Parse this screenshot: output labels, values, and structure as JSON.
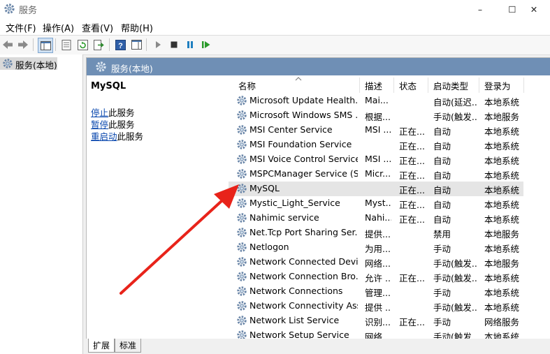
{
  "window": {
    "title": "服务",
    "minimize": "–",
    "maximize": "☐",
    "close": "✕"
  },
  "menu": [
    "文件(F)",
    "操作(A)",
    "查看(V)",
    "帮助(H)"
  ],
  "tree": {
    "root_label": "服务(本地)"
  },
  "panel": {
    "header": "服务(本地)",
    "selected_service": "MySQL",
    "actions": [
      {
        "link": "停止",
        "rest": "此服务"
      },
      {
        "link": "暂停",
        "rest": "此服务"
      },
      {
        "link": "重启动",
        "rest": "此服务"
      }
    ]
  },
  "columns": {
    "name": "名称",
    "desc": "描述",
    "status": "状态",
    "startup": "启动类型",
    "logon": "登录为"
  },
  "rows": [
    {
      "name": "Microsoft Update Health...",
      "desc": "Mai...",
      "status": "",
      "startup": "自动(延迟...",
      "logon": "本地系统"
    },
    {
      "name": "Microsoft Windows SMS ...",
      "desc": "根据...",
      "status": "",
      "startup": "手动(触发...",
      "logon": "本地服务"
    },
    {
      "name": "MSI Center Service",
      "desc": "MSI ...",
      "status": "正在...",
      "startup": "自动",
      "logon": "本地系统"
    },
    {
      "name": "MSI Foundation Service",
      "desc": "",
      "status": "正在...",
      "startup": "自动",
      "logon": "本地系统"
    },
    {
      "name": "MSI Voice Control Service",
      "desc": "MSI ...",
      "status": "正在...",
      "startup": "自动",
      "logon": "本地系统"
    },
    {
      "name": "MSPCManager Service (S...",
      "desc": "Micr...",
      "status": "正在...",
      "startup": "自动",
      "logon": "本地系统"
    },
    {
      "name": "MySQL",
      "desc": "",
      "status": "正在...",
      "startup": "自动",
      "logon": "本地系统",
      "selected": true
    },
    {
      "name": "Mystic_Light_Service",
      "desc": "Myst...",
      "status": "正在...",
      "startup": "自动",
      "logon": "本地系统"
    },
    {
      "name": "Nahimic service",
      "desc": "Nahi...",
      "status": "正在...",
      "startup": "自动",
      "logon": "本地系统"
    },
    {
      "name": "Net.Tcp Port Sharing Ser...",
      "desc": "提供...",
      "status": "",
      "startup": "禁用",
      "logon": "本地服务"
    },
    {
      "name": "Netlogon",
      "desc": "为用...",
      "status": "",
      "startup": "手动",
      "logon": "本地系统"
    },
    {
      "name": "Network Connected Devi...",
      "desc": "网络...",
      "status": "",
      "startup": "手动(触发...",
      "logon": "本地服务"
    },
    {
      "name": "Network Connection Bro...",
      "desc": "允许 ...",
      "status": "正在...",
      "startup": "手动(触发...",
      "logon": "本地系统"
    },
    {
      "name": "Network Connections",
      "desc": "管理...",
      "status": "",
      "startup": "手动",
      "logon": "本地系统"
    },
    {
      "name": "Network Connectivity Ass...",
      "desc": "提供 ...",
      "status": "",
      "startup": "手动(触发...",
      "logon": "本地系统"
    },
    {
      "name": "Network List Service",
      "desc": "识别...",
      "status": "正在...",
      "startup": "手动",
      "logon": "网络服务"
    },
    {
      "name": "Network Setup Service",
      "desc": "网络...",
      "status": "",
      "startup": "手动(触发...",
      "logon": "本地系统"
    }
  ],
  "tabs": [
    "扩展",
    "标准"
  ],
  "colors": {
    "panel_header": "#6f8fb5",
    "arrow": "#e8231a",
    "link": "#0645ad"
  }
}
